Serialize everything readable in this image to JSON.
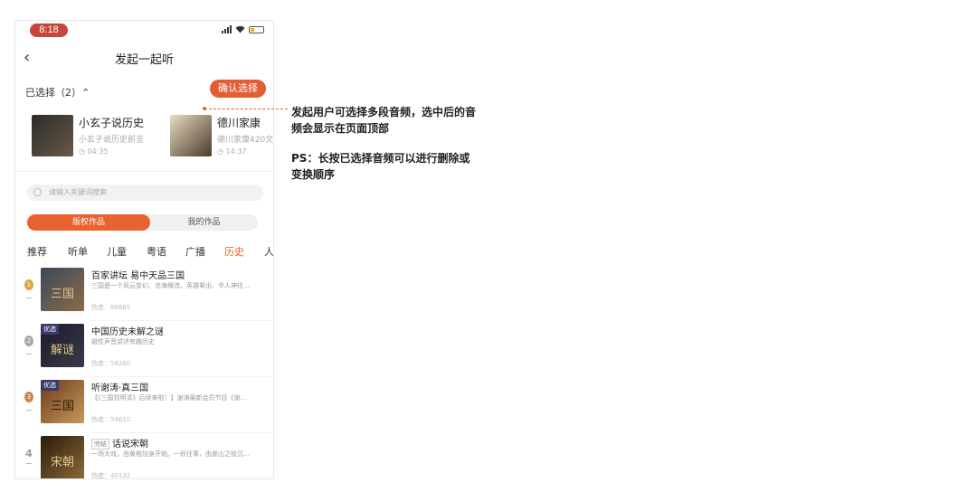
{
  "status_bar": {
    "time": "8:18"
  },
  "nav": {
    "back": "‹",
    "title": "发起一起听"
  },
  "selected": {
    "label": "已选择（2）⌃",
    "confirm": "确认选择",
    "items": [
      {
        "title": "小玄子说历史",
        "desc": "小玄子说历史前言",
        "duration": "◷ 04:35"
      },
      {
        "title": "德川家康",
        "desc": "德川家康420文",
        "duration": "◷ 14:37"
      }
    ]
  },
  "search": {
    "placeholder": "请输入关键词搜索"
  },
  "segments": {
    "active": "版权作品",
    "inactive": "我的作品"
  },
  "categories": [
    "推荐",
    "听单",
    "儿童",
    "粤语",
    "广播",
    "历史",
    "人"
  ],
  "active_category": "历史",
  "list": [
    {
      "rank": "1",
      "title": "百家讲坛 易中天品三国",
      "done": "",
      "badge": "",
      "cover_text": "三国",
      "desc": "三国是一个风云变幻、沧海横流、英雄辈出、令人神往...",
      "hot": "热度：86685"
    },
    {
      "rank": "2",
      "title": "中国历史未解之谜",
      "done": "",
      "badge": "优选",
      "cover_text": "解谜",
      "desc": "磁性声音讲述有趣历史",
      "hot": "热度：58260"
    },
    {
      "rank": "3",
      "title": "听谢涛·真三国",
      "done": "",
      "badge": "优选",
      "cover_text": "三国",
      "desc": "【《三国到明清》后续来啦！】谢涛最新会员节目《谢...",
      "hot": "热度：54610"
    },
    {
      "rank": "4",
      "title": "话说宋朝",
      "done": "完结",
      "badge": "",
      "cover_text": "宋朝",
      "desc": "一场大戏，由黄袍加身开始。一段往事，由崖山之役沉...",
      "hot": "热度：40132"
    }
  ],
  "annotations": {
    "note1": "发起用户可选择多段音频，选中后的音频会显示在页面顶部",
    "note2": "PS：长按已选择音频可以进行删除或变换顺序"
  },
  "colors": {
    "accent": "#e35d34",
    "medal_gold": "#d9a441",
    "medal_silver": "#a8a8a8",
    "medal_bronze": "#c8864a"
  }
}
